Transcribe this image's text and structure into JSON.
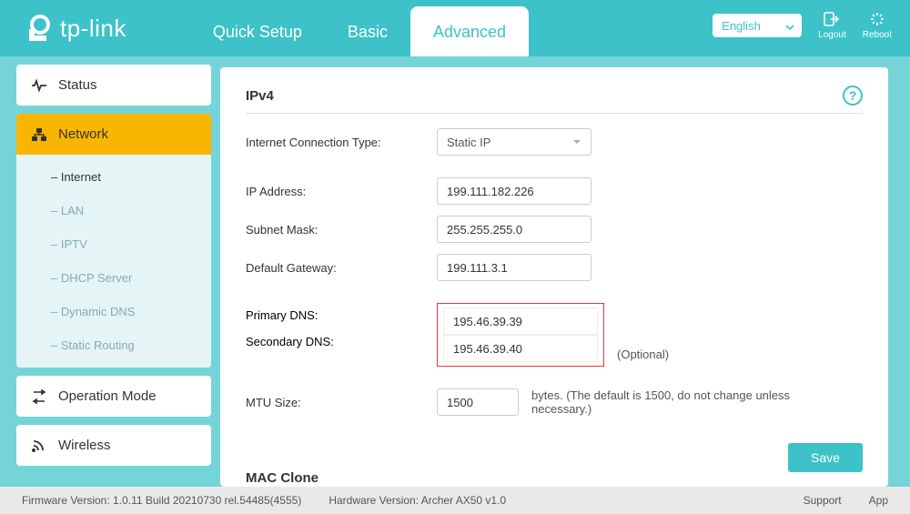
{
  "brand": "tp-link",
  "header": {
    "tabs": {
      "quick_setup": "Quick Setup",
      "basic": "Basic",
      "advanced": "Advanced"
    },
    "language": "English",
    "logout": "Logout",
    "reboot": "Reboot"
  },
  "sidebar": {
    "status": "Status",
    "network": "Network",
    "submenu": {
      "internet": "Internet",
      "lan": "LAN",
      "iptv": "IPTV",
      "dhcp": "DHCP Server",
      "ddns": "Dynamic DNS",
      "static_routing": "Static Routing"
    },
    "operation_mode": "Operation Mode",
    "wireless": "Wireless"
  },
  "ipv4": {
    "title": "IPv4",
    "connection_type_label": "Internet Connection Type:",
    "connection_type_value": "Static IP",
    "ip_label": "IP Address:",
    "ip_value": "199.111.182.226",
    "mask_label": "Subnet Mask:",
    "mask_value": "255.255.255.0",
    "gw_label": "Default Gateway:",
    "gw_value": "199.111.3.1",
    "pdns_label": "Primary DNS:",
    "pdns_value": "195.46.39.39",
    "sdns_label": "Secondary DNS:",
    "sdns_value": "195.46.39.40",
    "optional": "(Optional)",
    "mtu_label": "MTU Size:",
    "mtu_value": "1500",
    "mtu_hint": "bytes. (The default is 1500, do not change unless necessary.)",
    "save": "Save"
  },
  "mac_clone": {
    "title": "MAC Clone"
  },
  "footer": {
    "firmware_label": "Firmware Version:",
    "firmware_value": "1.0.11 Build 20210730 rel.54485(4555)",
    "hardware_label": "Hardware Version:",
    "hardware_value": "Archer AX50 v1.0",
    "support": "Support",
    "app": "App"
  },
  "colors": {
    "accent": "#3cc2c8",
    "highlight": "#f9b600"
  }
}
